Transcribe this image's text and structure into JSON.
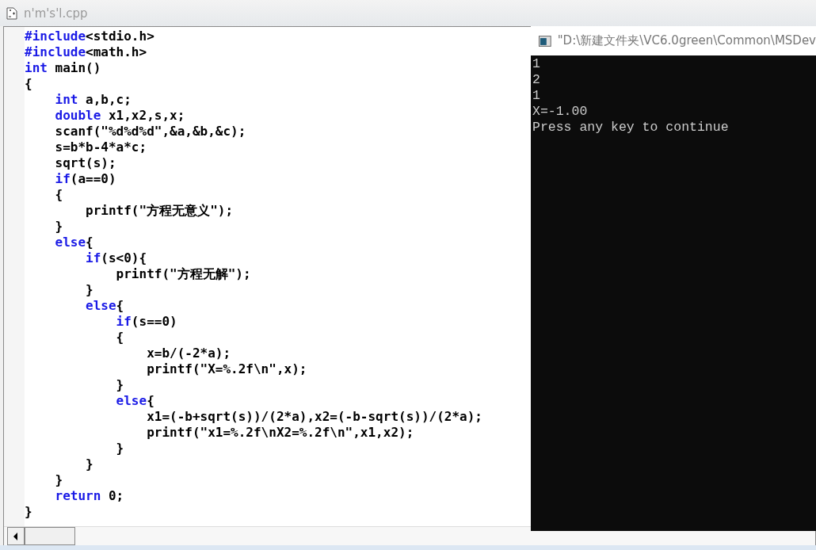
{
  "document_tab": {
    "title": "n'm's'l.cpp"
  },
  "code_lines": [
    [
      {
        "text": "#include",
        "kind": "keyword"
      },
      {
        "text": "<stdio.h>",
        "kind": "plain"
      }
    ],
    [
      {
        "text": "#include",
        "kind": "keyword"
      },
      {
        "text": "<math.h>",
        "kind": "plain"
      }
    ],
    [
      {
        "text": "int",
        "kind": "keyword"
      },
      {
        "text": " main()",
        "kind": "plain"
      }
    ],
    [
      {
        "text": "{",
        "kind": "plain"
      }
    ],
    [
      {
        "text": "    int",
        "kind": "keyword"
      },
      {
        "text": " a,b,c;",
        "kind": "plain"
      }
    ],
    [
      {
        "text": "    double",
        "kind": "keyword"
      },
      {
        "text": " x1,x2,s,x;",
        "kind": "plain"
      }
    ],
    [
      {
        "text": "    scanf(\"%d%d%d\",&a,&b,&c);",
        "kind": "plain"
      }
    ],
    [
      {
        "text": "    s=b*b-4*a*c;",
        "kind": "plain"
      }
    ],
    [
      {
        "text": "    sqrt(s);",
        "kind": "plain"
      }
    ],
    [
      {
        "text": "    if",
        "kind": "keyword"
      },
      {
        "text": "(a==0)",
        "kind": "plain"
      }
    ],
    [
      {
        "text": "    {",
        "kind": "plain"
      }
    ],
    [
      {
        "text": "        printf(\"方程无意义\");",
        "kind": "plain"
      }
    ],
    [
      {
        "text": "    }",
        "kind": "plain"
      }
    ],
    [
      {
        "text": "    else",
        "kind": "keyword"
      },
      {
        "text": "{",
        "kind": "plain"
      }
    ],
    [
      {
        "text": "        if",
        "kind": "keyword"
      },
      {
        "text": "(s<0){",
        "kind": "plain"
      }
    ],
    [
      {
        "text": "            printf(\"方程无解\");",
        "kind": "plain"
      }
    ],
    [
      {
        "text": "        }",
        "kind": "plain"
      }
    ],
    [
      {
        "text": "        else",
        "kind": "keyword"
      },
      {
        "text": "{",
        "kind": "plain"
      }
    ],
    [
      {
        "text": "            if",
        "kind": "keyword"
      },
      {
        "text": "(s==0)",
        "kind": "plain"
      }
    ],
    [
      {
        "text": "            {",
        "kind": "plain"
      }
    ],
    [
      {
        "text": "                x=b/(-2*a);",
        "kind": "plain"
      }
    ],
    [
      {
        "text": "                printf(\"X=%.2f\\n\",x);",
        "kind": "plain"
      }
    ],
    [
      {
        "text": "            }",
        "kind": "plain"
      }
    ],
    [
      {
        "text": "            else",
        "kind": "keyword"
      },
      {
        "text": "{",
        "kind": "plain"
      }
    ],
    [
      {
        "text": "                x1=(-b+sqrt(s))/(2*a),x2=(-b-sqrt(s))/(2*a);",
        "kind": "plain"
      }
    ],
    [
      {
        "text": "                printf(\"x1=%.2f\\nX2=%.2f\\n\",x1,x2);",
        "kind": "plain"
      }
    ],
    [
      {
        "text": "            }",
        "kind": "plain"
      }
    ],
    [
      {
        "text": "        }",
        "kind": "plain"
      }
    ],
    [
      {
        "text": "    }",
        "kind": "plain"
      }
    ],
    [
      {
        "text": "    return",
        "kind": "keyword"
      },
      {
        "text": " 0;",
        "kind": "plain"
      }
    ],
    [
      {
        "text": "}",
        "kind": "plain"
      }
    ]
  ],
  "console_window": {
    "title": "\"D:\\新建文件夹\\VC6.0green\\Common\\MSDev",
    "output_lines": [
      "1",
      "2",
      "1",
      "X=-1.00",
      "Press any key to continue"
    ]
  }
}
